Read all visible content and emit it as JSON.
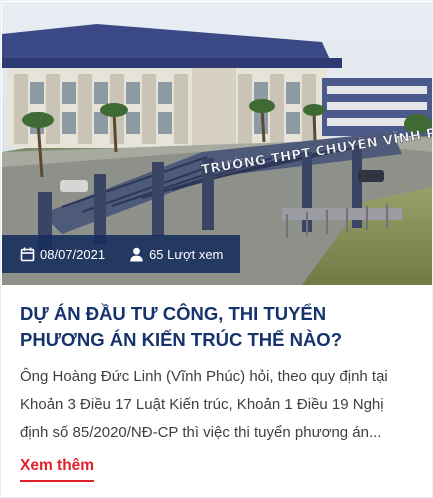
{
  "article": {
    "image_sign_text": "TRƯỜNG THPT CHUYÊN VĨNH PHÚC",
    "date": "08/07/2021",
    "views": "65 Lượt xem",
    "title": "DỰ ÁN ĐẦU TƯ CÔNG, THI TUYỂN PHƯƠNG ÁN KIẾN TRÚC THẾ NÀO?",
    "excerpt": "Ông Hoàng Đức Linh (Vĩnh Phúc) hỏi, theo quy định tại Khoản 3 Điều 17 Luật Kiến trúc, Khoản 1 Điều 19 Nghị định số 85/2020/NĐ-CP thì việc thi tuyển phương án...",
    "read_more": "Xem thêm"
  },
  "icons": {
    "date": "calendar-icon",
    "views": "user-icon"
  },
  "colors": {
    "title": "#16336e",
    "meta_bar": "#142c5c",
    "read_more": "#e3202a",
    "text": "#3c3f44"
  }
}
